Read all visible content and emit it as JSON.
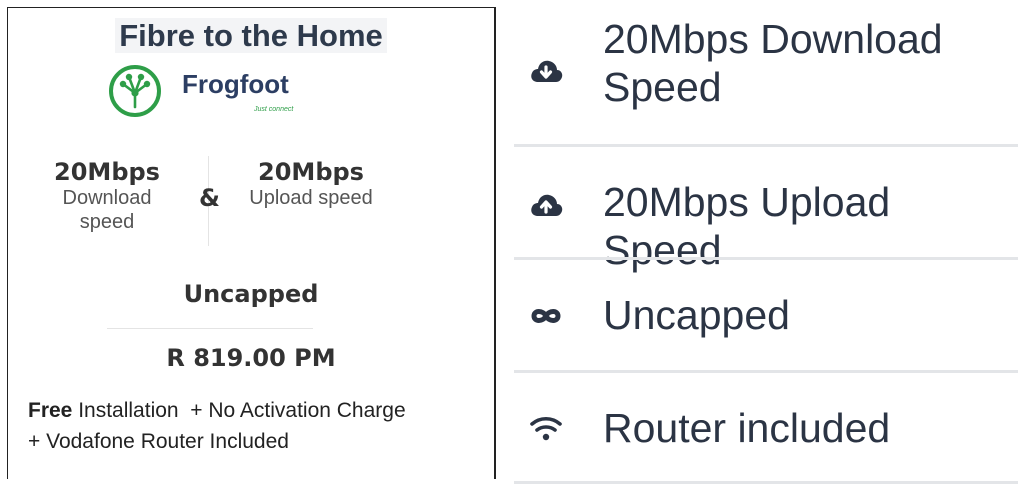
{
  "left_card": {
    "title": "Fibre to the Home",
    "logo": {
      "wordmark": "Frogfoot",
      "tagline": "Just connect"
    },
    "download": {
      "value": "20Mbps",
      "label_line1": "Download",
      "label_line2": "speed"
    },
    "ampersand": "&",
    "upload": {
      "value": "20Mbps",
      "label": "Upload speed"
    },
    "uncapped": "Uncapped",
    "price": "R 819.00 PM",
    "offer": {
      "free": "Free",
      "line1_rest": " Installation  + No Activation Charge",
      "line2": "+ Vodafone Router Included"
    }
  },
  "features": [
    {
      "icon": "cloud-download-icon",
      "label_line1": "20Mbps Download",
      "label_line2": "Speed"
    },
    {
      "icon": "cloud-upload-icon",
      "label": "20Mbps Upload Speed"
    },
    {
      "icon": "infinity-icon",
      "label": "Uncapped"
    },
    {
      "icon": "wifi-icon",
      "label": "Router included"
    }
  ],
  "colors": {
    "logo_green": "#2e9e48",
    "logo_navy": "#2c3e63",
    "text_dark": "#2b3444"
  }
}
